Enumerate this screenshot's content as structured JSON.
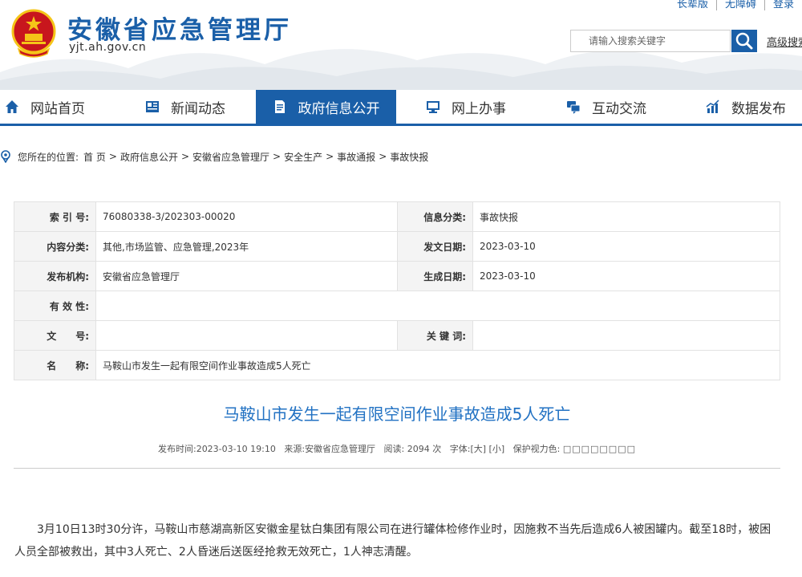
{
  "header": {
    "site_name": "安徽省应急管理厅",
    "domain": "yjt.ah.gov.cn",
    "top_links": [
      "长辈版",
      "无障碍",
      "登录"
    ],
    "search_placeholder": "请输入搜索关键字",
    "advanced_search": "高级搜索"
  },
  "nav": [
    {
      "label": "网站首页",
      "icon": "home-icon"
    },
    {
      "label": "新闻动态",
      "icon": "news-icon"
    },
    {
      "label": "政府信息公开",
      "icon": "document-icon",
      "active": true
    },
    {
      "label": "网上办事",
      "icon": "monitor-icon"
    },
    {
      "label": "互动交流",
      "icon": "chat-icon"
    },
    {
      "label": "数据发布",
      "icon": "chart-icon"
    }
  ],
  "breadcrumb": {
    "prefix": "您所在的位置:",
    "items": [
      "首 页",
      "政府信息公开",
      "安徽省应急管理厅",
      "安全生产",
      "事故通报",
      "事故快报"
    ]
  },
  "info": {
    "index_label": "索 引 号:",
    "index_value": "76080338-3/202303-00020",
    "category_label": "信息分类:",
    "category_value": "事故快报",
    "content_label": "内容分类:",
    "content_value": "其他,市场监管、应急管理,2023年",
    "issue_date_label": "发文日期:",
    "issue_date_value": "2023-03-10",
    "publisher_label": "发布机构:",
    "publisher_value": "安徽省应急管理厅",
    "created_label": "生成日期:",
    "created_value": "2023-03-10",
    "validity_label": "有 效 性:",
    "doc_no_label": "文　　号:",
    "keywords_label": "关 键 词:",
    "name_label": "名　　称:",
    "name_value": "马鞍山市发生一起有限空间作业事故造成5人死亡"
  },
  "article": {
    "title": "马鞍山市发生一起有限空间作业事故造成5人死亡",
    "meta_publish": "发布时间:2023-03-10 19:10",
    "meta_source": "来源:安徽省应急管理厅",
    "meta_views": "阅读: 2094 次",
    "meta_font": "字体:[大] [小]",
    "meta_eye": "保护视力色:",
    "eye_boxes": "□□□□□□□□",
    "paragraph": "3月10日13时30分许，马鞍山市慈湖高新区安徽金星钛白集团有限公司在进行罐体检修作业时，因施救不当先后造成6人被困罐内。截至18时，被困人员全部被救出，其中3人死亡、2人昏迷后送医经抢救无效死亡，1人神志清醒。"
  },
  "colors": {
    "brand": "#1a5fa8",
    "title_blue": "#2272c3",
    "emblem_red": "#c8161d",
    "emblem_gold": "#f5c518"
  }
}
